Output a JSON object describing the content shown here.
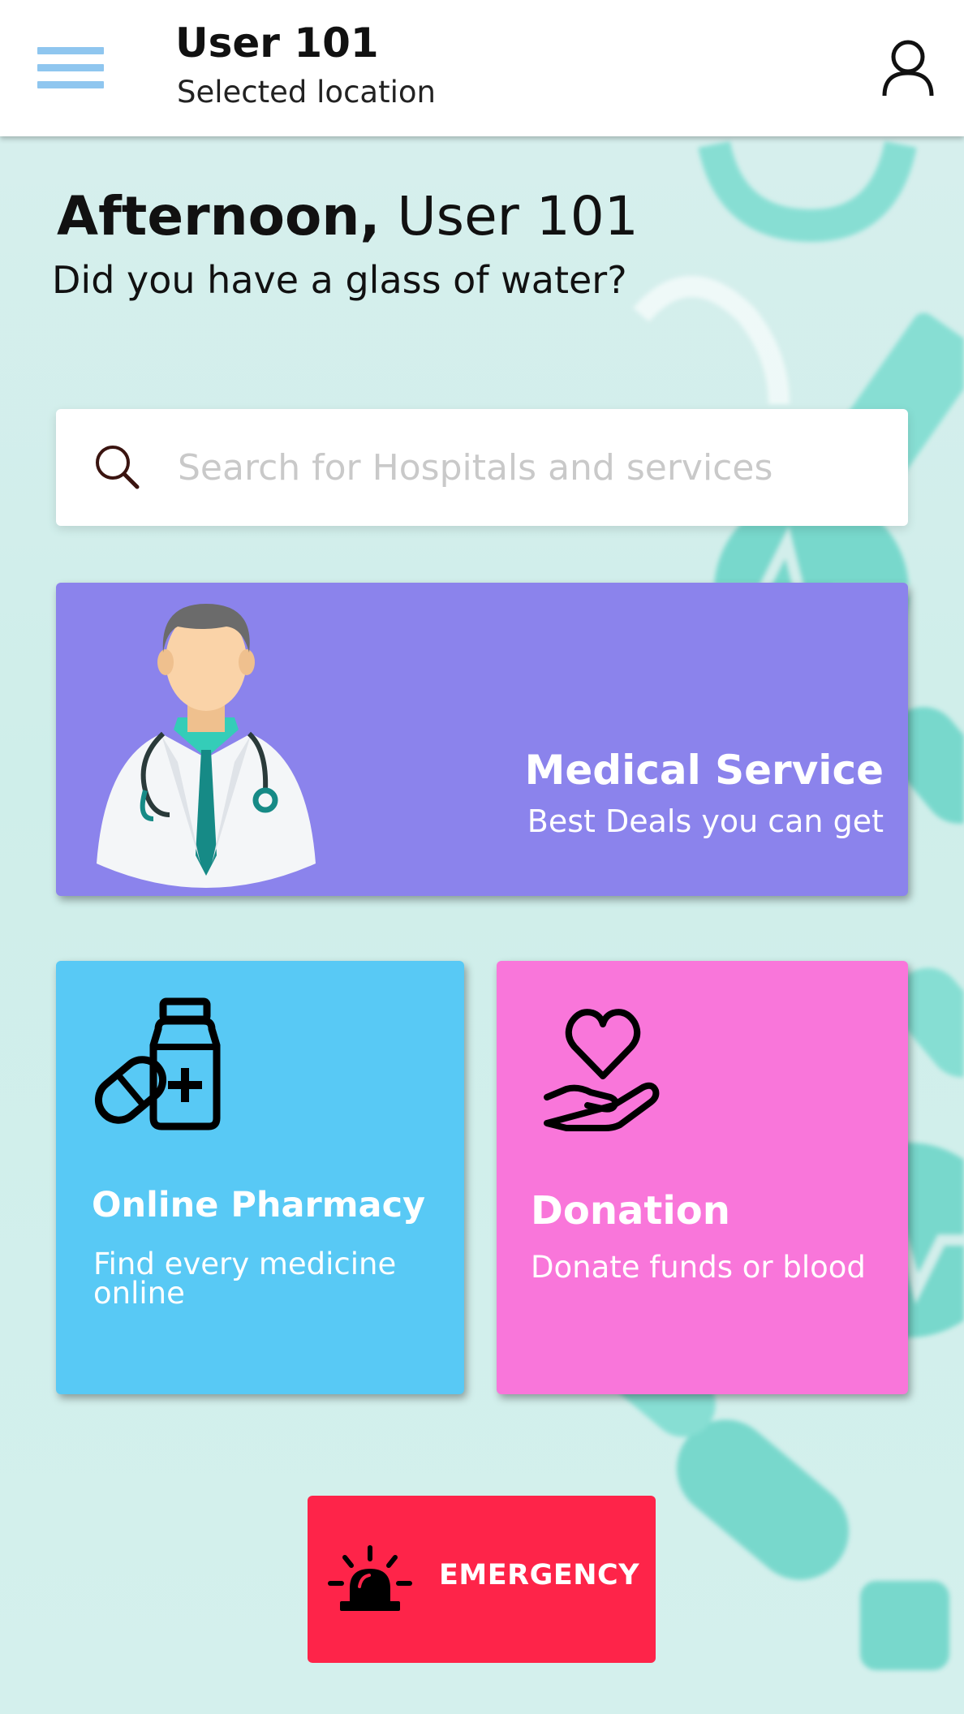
{
  "header": {
    "user_name": "User 101",
    "location": "Selected location",
    "menu_icon": "hamburger-menu-icon",
    "profile_icon": "user-profile-icon"
  },
  "greeting": {
    "time_of_day": "Afternoon,",
    "name": "User 101",
    "question": "Did you have a glass of water?"
  },
  "search": {
    "placeholder": "Search for Hospitals and services",
    "value": "",
    "icon": "search-icon"
  },
  "cards": {
    "medical": {
      "title": "Medical Service",
      "subtitle": "Best Deals you can get",
      "color": "#8b83ec",
      "icon": "doctor-illustration"
    },
    "pharmacy": {
      "title": "Online Pharmacy",
      "subtitle": "Find every medicine online",
      "color": "#58c9f5",
      "icon": "medicine-bottle-pill-icon"
    },
    "donation": {
      "title": "Donation",
      "subtitle": "Donate funds or blood",
      "color": "#f976da",
      "icon": "heart-in-hand-icon"
    }
  },
  "emergency": {
    "label": "EMERGENCY",
    "color": "#fe2449",
    "icon": "siren-icon"
  },
  "colors": {
    "background": "#d3eeeb",
    "menu_accent": "#8fc6ef",
    "decor": "#6fd6c9"
  }
}
